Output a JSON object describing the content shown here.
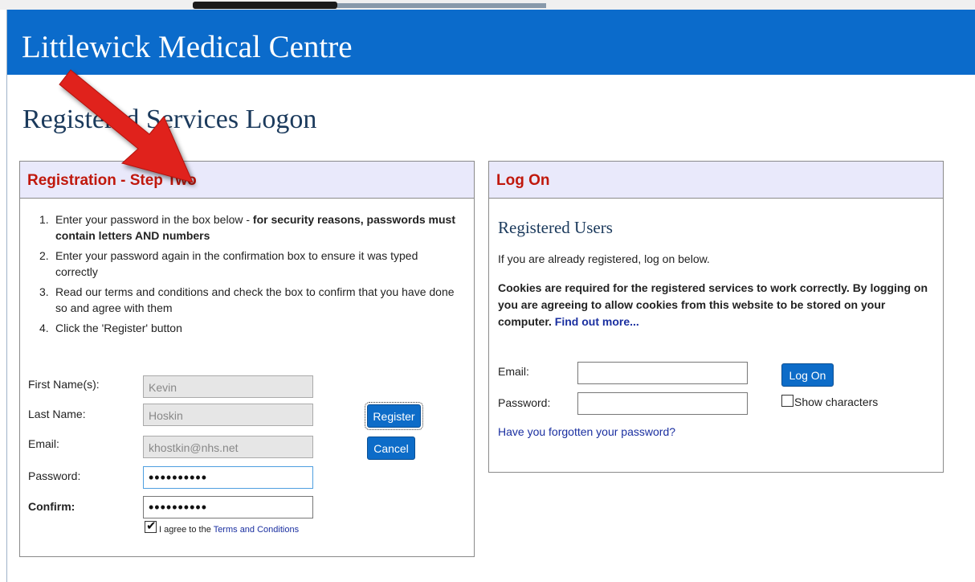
{
  "header": {
    "title": "Littlewick Medical Centre"
  },
  "page": {
    "title": "Registered Services Logon"
  },
  "registration": {
    "heading": "Registration - Step Two",
    "steps": [
      {
        "num": "1.",
        "text": "Enter your password in the box below - ",
        "bold": "for security reasons, passwords must contain letters AND numbers"
      },
      {
        "num": "2.",
        "text": "Enter your password again in the confirmation box to ensure it was typed correctly",
        "bold": ""
      },
      {
        "num": "3.",
        "text": "Read our terms and conditions and check the box to confirm that you have done so and agree with them",
        "bold": ""
      },
      {
        "num": "4.",
        "text": "Click the 'Register' button",
        "bold": ""
      }
    ],
    "first_name_label": "First Name(s):",
    "first_name_value": "Kevin",
    "last_name_label": "Last Name:",
    "last_name_value": "Hoskin",
    "email_label": "Email:",
    "email_value": "khostkin@nhs.net",
    "password_label": "Password:",
    "password_value": "••••••••••",
    "confirm_label": "Confirm:",
    "confirm_value": "••••••••••",
    "agree_text": "I agree to the ",
    "terms_link": "Terms and Conditions",
    "agree_checked": true,
    "register_button": "Register",
    "cancel_button": "Cancel"
  },
  "logon": {
    "heading": "Log On",
    "subtitle": "Registered Users",
    "intro": "If you are already registered, log on below.",
    "cookies_text": "Cookies are required for the registered services to work correctly. By logging on you are agreeing to allow cookies from this website to be stored on your computer. ",
    "find_out_more": "Find out more...",
    "email_label": "Email:",
    "email_value": "",
    "password_label": "Password:",
    "password_value": "",
    "logon_button": "Log On",
    "show_characters": "Show characters",
    "show_characters_checked": false,
    "forgot_link": "Have you forgotten your password?"
  },
  "colors": {
    "header_bg": "#0b6bcb",
    "panel_heading": "#c0180c",
    "panel_head_bg": "#e9e9fb",
    "button_bg": "#0d6cc8",
    "arrow": "#e0201c"
  }
}
